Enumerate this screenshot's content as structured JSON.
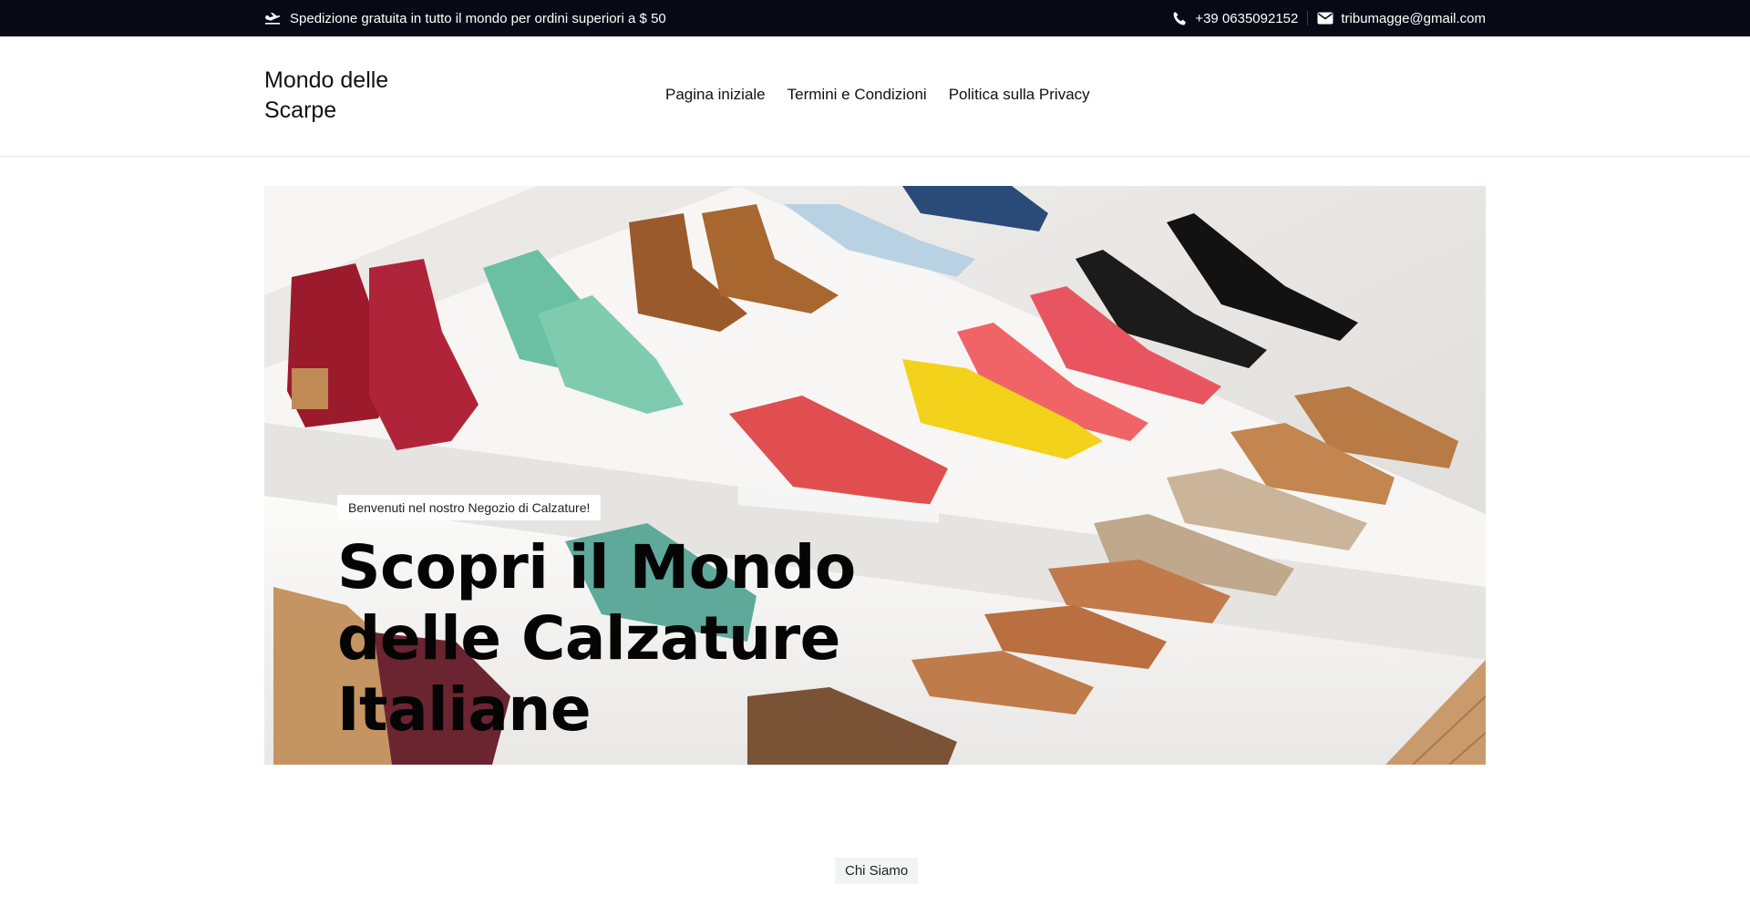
{
  "topbar": {
    "shipping_text": "Spedizione gratuita in tutto il mondo per ordini superiori a $ 50",
    "shipping_icon": "airplane-icon",
    "phone": "+39 0635092152",
    "phone_icon": "phone-icon",
    "email": "tribumagge@gmail.com",
    "email_icon": "envelope-icon",
    "bg_color": "#070a14"
  },
  "header": {
    "brand": "Mondo delle Scarpe",
    "nav": [
      {
        "label": "Pagina iniziale"
      },
      {
        "label": "Termini e Condizioni"
      },
      {
        "label": "Politica sulla Privacy"
      }
    ]
  },
  "hero": {
    "badge": "Benvenuti nel nostro Negozio di Calzature!",
    "title": "Scopri il Mondo delle Calzature Italiane",
    "image": "shoes-on-white-steps"
  },
  "about": {
    "badge": "Chi Siamo"
  }
}
